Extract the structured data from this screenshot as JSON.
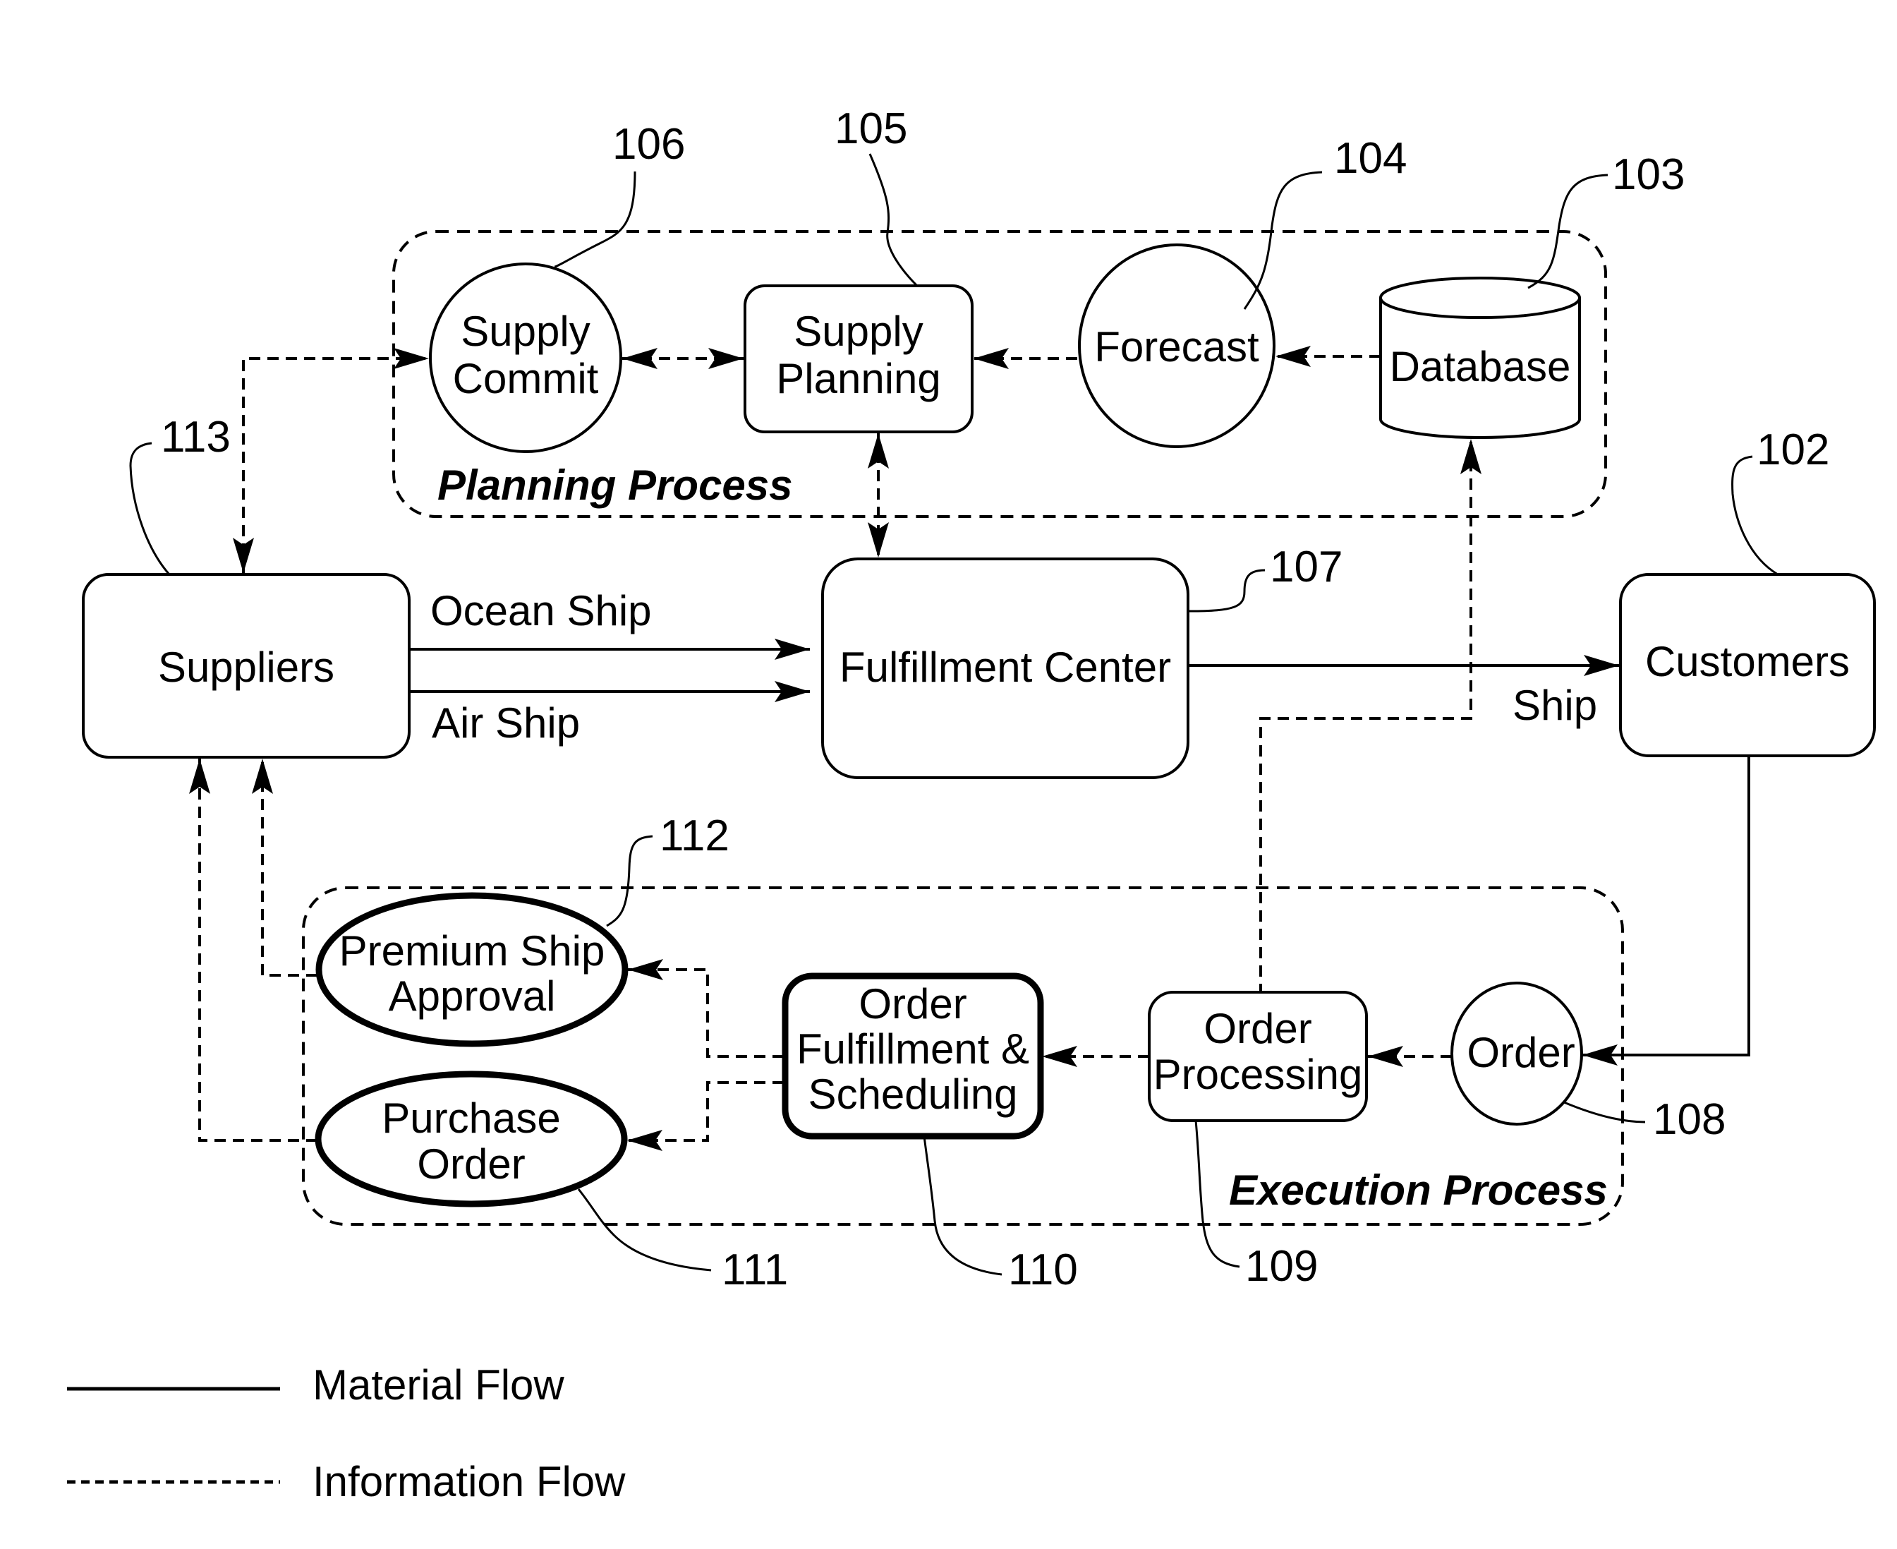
{
  "diagram": {
    "groups": {
      "planning": "Planning Process",
      "execution": "Execution Process"
    },
    "nodes": {
      "supply_commit": [
        "Supply",
        "Commit"
      ],
      "supply_planning": [
        "Supply",
        "Planning"
      ],
      "forecast": "Forecast",
      "database": "Database",
      "suppliers": "Suppliers",
      "fulfillment_center": "Fulfillment Center",
      "customers": "Customers",
      "premium_ship_approval": [
        "Premium Ship",
        "Approval"
      ],
      "purchase_order": [
        "Purchase",
        "Order"
      ],
      "order_fulfillment_scheduling": [
        "Order",
        "Fulfillment &",
        "Scheduling"
      ],
      "order_processing": [
        "Order",
        "Processing"
      ],
      "order": "Order"
    },
    "edge_labels": {
      "ocean_ship": "Ocean Ship",
      "air_ship": "Air Ship",
      "ship": "Ship"
    },
    "references": {
      "customers": "102",
      "database": "103",
      "forecast": "104",
      "supply_planning": "105",
      "supply_commit": "106",
      "fulfillment_center": "107",
      "order": "108",
      "order_processing": "109",
      "order_fulfillment_scheduling": "110",
      "purchase_order": "111",
      "premium_ship_approval": "112",
      "suppliers": "113"
    },
    "legend": {
      "material_flow": "Material Flow",
      "information_flow": "Information Flow"
    }
  }
}
